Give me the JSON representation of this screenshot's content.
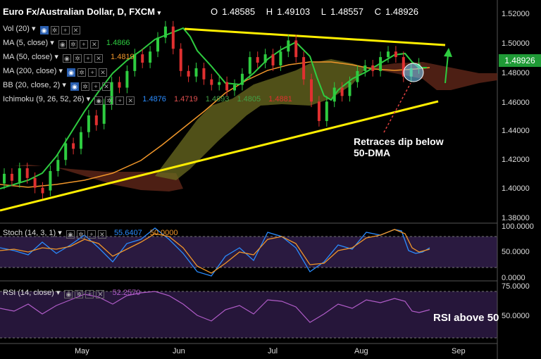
{
  "header": {
    "title": "Euro Fx/Australian Dollar, D, FXCM",
    "open_label": "O",
    "open": "1.48585",
    "high_label": "H",
    "high": "1.49103",
    "low_label": "L",
    "low": "1.48557",
    "close_label": "C",
    "close": "1.48926"
  },
  "indicators": [
    {
      "name": "Vol (20)",
      "values": []
    },
    {
      "name": "MA (5, close)",
      "values": [
        "1.4866"
      ],
      "color": "#2ecc40"
    },
    {
      "name": "MA (50, close)",
      "values": [
        "1.4819"
      ],
      "color": "#f0962a"
    },
    {
      "name": "MA (200, close)",
      "values": []
    },
    {
      "name": "BB (20, close, 2)",
      "values": []
    },
    {
      "name": "Ichimoku (9, 26, 52, 26)",
      "values": [
        "1.4876",
        "1.4719",
        "1.4893",
        "1.4805",
        "1.4881"
      ],
      "colors": [
        "#2a8cff",
        "#e05050",
        "#43a047",
        "#43a047",
        "#e03030"
      ]
    }
  ],
  "price_badge": "1.48926",
  "annotations": {
    "retrace": [
      "Retraces dip below",
      "50-DMA"
    ],
    "rsi": "RSI above 50"
  },
  "stoch_panel": {
    "label": "Stoch (14, 3, 1)",
    "k": "55.6407",
    "d": "50.0000",
    "k_color": "#2a8cff",
    "d_color": "#f0962a"
  },
  "rsi_panel": {
    "label": "RSI (14, close)",
    "value": "52.2570",
    "color": "#b05cc8"
  },
  "colors": {
    "up": "#2ecc40",
    "down": "#e03030",
    "ma5": "#2ecc40",
    "ma50": "#f0962a",
    "trend": "#ffee00",
    "cloud_up": "#6b6b20",
    "cloud_down": "#5a2418"
  },
  "chart_data": {
    "type": "candlestick",
    "x_ticks": [
      "May",
      "Jun",
      "Jul",
      "Aug",
      "Sep"
    ],
    "y_ticks": [
      "1.52000",
      "1.50000",
      "1.48000",
      "1.46000",
      "1.44000",
      "1.42000",
      "1.40000",
      "1.38000"
    ],
    "ylim": [
      1.375,
      1.528
    ],
    "candles": [
      {
        "x": 0,
        "o": 1.403,
        "c": 1.41
      },
      {
        "x": 2,
        "o": 1.41,
        "c": 1.405
      },
      {
        "x": 4,
        "o": 1.404,
        "c": 1.414
      },
      {
        "x": 6,
        "o": 1.414,
        "c": 1.407
      },
      {
        "x": 8,
        "o": 1.407,
        "c": 1.4
      },
      {
        "x": 10,
        "o": 1.4,
        "c": 1.396
      },
      {
        "x": 12,
        "o": 1.398,
        "c": 1.412
      },
      {
        "x": 14,
        "o": 1.412,
        "c": 1.42
      },
      {
        "x": 16,
        "o": 1.42,
        "c": 1.432
      },
      {
        "x": 18,
        "o": 1.432,
        "c": 1.428
      },
      {
        "x": 20,
        "o": 1.428,
        "c": 1.44
      },
      {
        "x": 22,
        "o": 1.44,
        "c": 1.452
      },
      {
        "x": 24,
        "o": 1.452,
        "c": 1.445
      },
      {
        "x": 26,
        "o": 1.446,
        "c": 1.46
      },
      {
        "x": 28,
        "o": 1.46,
        "c": 1.476
      },
      {
        "x": 30,
        "o": 1.476,
        "c": 1.472
      },
      {
        "x": 32,
        "o": 1.472,
        "c": 1.484
      },
      {
        "x": 34,
        "o": 1.484,
        "c": 1.496
      },
      {
        "x": 36,
        "o": 1.496,
        "c": 1.49
      },
      {
        "x": 38,
        "o": 1.49,
        "c": 1.498
      },
      {
        "x": 40,
        "o": 1.498,
        "c": 1.508
      },
      {
        "x": 42,
        "o": 1.508,
        "c": 1.516
      },
      {
        "x": 44,
        "o": 1.516,
        "c": 1.5
      },
      {
        "x": 46,
        "o": 1.5,
        "c": 1.484
      },
      {
        "x": 48,
        "o": 1.484,
        "c": 1.48
      },
      {
        "x": 50,
        "o": 1.48,
        "c": 1.486
      },
      {
        "x": 52,
        "o": 1.486,
        "c": 1.478
      },
      {
        "x": 54,
        "o": 1.478,
        "c": 1.474
      },
      {
        "x": 56,
        "o": 1.474,
        "c": 1.476
      },
      {
        "x": 58,
        "o": 1.476,
        "c": 1.47
      },
      {
        "x": 60,
        "o": 1.47,
        "c": 1.474
      },
      {
        "x": 62,
        "o": 1.474,
        "c": 1.482
      },
      {
        "x": 64,
        "o": 1.482,
        "c": 1.494
      },
      {
        "x": 66,
        "o": 1.494,
        "c": 1.49
      },
      {
        "x": 68,
        "o": 1.49,
        "c": 1.496
      },
      {
        "x": 70,
        "o": 1.496,
        "c": 1.488
      },
      {
        "x": 72,
        "o": 1.488,
        "c": 1.498
      },
      {
        "x": 74,
        "o": 1.498,
        "c": 1.506
      },
      {
        "x": 76,
        "o": 1.506,
        "c": 1.494
      },
      {
        "x": 78,
        "o": 1.494,
        "c": 1.478
      },
      {
        "x": 80,
        "o": 1.478,
        "c": 1.462
      },
      {
        "x": 82,
        "o": 1.462,
        "c": 1.448
      },
      {
        "x": 84,
        "o": 1.448,
        "c": 1.462
      },
      {
        "x": 86,
        "o": 1.462,
        "c": 1.472
      },
      {
        "x": 88,
        "o": 1.472,
        "c": 1.466
      },
      {
        "x": 90,
        "o": 1.466,
        "c": 1.476
      },
      {
        "x": 92,
        "o": 1.476,
        "c": 1.484
      },
      {
        "x": 94,
        "o": 1.484,
        "c": 1.488
      },
      {
        "x": 96,
        "o": 1.488,
        "c": 1.484
      },
      {
        "x": 98,
        "o": 1.484,
        "c": 1.494
      },
      {
        "x": 100,
        "o": 1.494,
        "c": 1.498
      },
      {
        "x": 102,
        "o": 1.498,
        "c": 1.494
      },
      {
        "x": 104,
        "o": 1.494,
        "c": 1.48
      },
      {
        "x": 106,
        "o": 1.48,
        "c": 1.486
      },
      {
        "x": 108,
        "o": 1.486,
        "c": 1.4893
      }
    ]
  }
}
